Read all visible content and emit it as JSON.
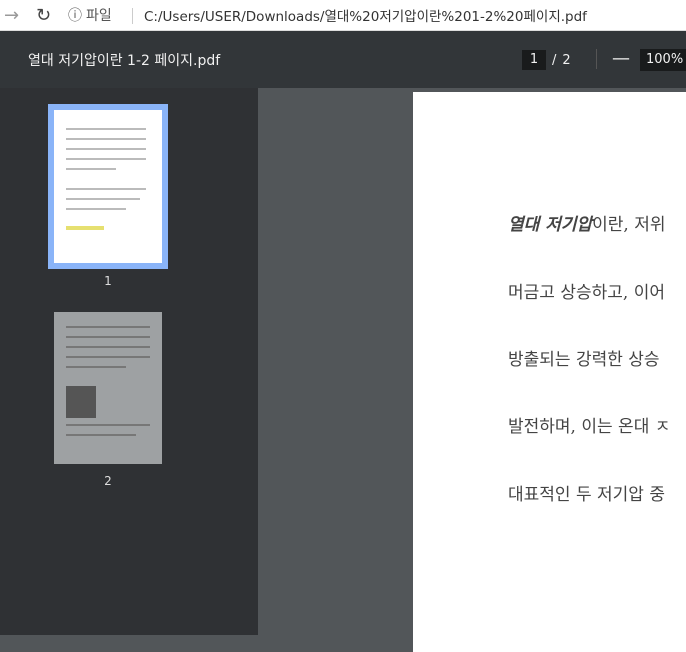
{
  "address_bar": {
    "info_label": "파일",
    "url": "C:/Users/USER/Downloads/열대%20저기압이란%201-2%20페이지.pdf"
  },
  "toolbar": {
    "title": "열대 저기압이란 1-2 페이지.pdf",
    "current_page": "1",
    "page_sep": "/",
    "total_pages": "2",
    "zoom_out": "—",
    "zoom": "100%"
  },
  "thumbnails": [
    {
      "label": "1"
    },
    {
      "label": "2"
    }
  ],
  "page": {
    "lines": [
      {
        "bold": "열대 저기압",
        "rest": "이란, 저위"
      },
      {
        "text": "머금고 상승하고, 이어"
      },
      {
        "text": "방출되는 강력한 상승"
      },
      {
        "text": "발전하며, 이는 온대 ㅈ"
      },
      {
        "text": "대표적인 두 저기압 중"
      }
    ]
  }
}
